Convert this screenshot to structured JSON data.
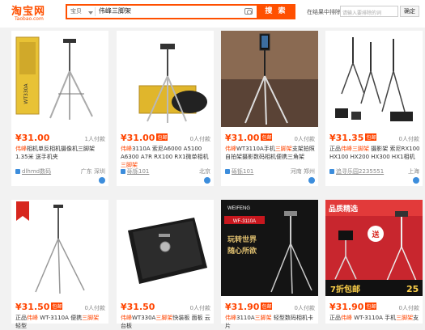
{
  "header": {
    "logo": "淘宝网",
    "logo_sub": "Taobao.com",
    "search_scope": "宝贝",
    "search_query": "伟峰三脚架",
    "search_button": "搜 索",
    "exclude_label": "在结果中排除",
    "exclude_placeholder": "请输入要排除的词",
    "exclude_button": "确定"
  },
  "products": [
    {
      "price": "¥31.00",
      "badge": "",
      "paid": "1人付款",
      "title_parts": [
        [
          "伟峰",
          true
        ],
        [
          "相机单反相机摄像机三脚架 1.35米 送手机夹",
          false
        ]
      ],
      "shop": "dlhmd数码",
      "location": "广东 深圳"
    },
    {
      "price": "¥31.00",
      "badge": "包邮",
      "paid": "0人付款",
      "title_parts": [
        [
          "伟峰",
          true
        ],
        [
          "3110A 索尼A6000 A5100 A6300 A7R RX100 RX1微单相机",
          false
        ],
        [
          "三脚架",
          true
        ]
      ],
      "shop": "砾铄101",
      "location": "北京"
    },
    {
      "price": "¥31.00",
      "badge": "包邮",
      "paid": "0人付款",
      "title_parts": [
        [
          "伟峰",
          true
        ],
        [
          "WT3110A手机",
          false
        ],
        [
          "三脚架",
          true
        ],
        [
          "支架拍照自拍架摄影数码相机便携三角架",
          false
        ]
      ],
      "shop": "砾铄101",
      "location": "河南 郑州"
    },
    {
      "price": "¥31.35",
      "badge": "包邮",
      "paid": "0人付款",
      "title_parts": [
        [
          "正品",
          false
        ],
        [
          "伟峰",
          true
        ],
        [
          "三脚架",
          true
        ],
        [
          " 摄影架 索尼RX100 HX100 HX200 HX300 HX1相机",
          false
        ]
      ],
      "shop": "追寻乐园2235551",
      "location": "上海"
    },
    {
      "price": "¥31.50",
      "badge": "包邮",
      "paid": "0人付款",
      "title_parts": [
        [
          "正品",
          false
        ],
        [
          "伟峰",
          true
        ],
        [
          " WT-3110A 便携",
          false
        ],
        [
          "三脚架",
          true
        ],
        [
          " 轻型",
          false
        ]
      ],
      "shop": "",
      "location": ""
    },
    {
      "price": "¥31.50",
      "badge": "",
      "paid": "0人付款",
      "title_parts": [
        [
          "伟峰",
          true
        ],
        [
          "WT330A",
          false
        ],
        [
          "三脚架",
          true
        ],
        [
          "快装板 面板 云台板",
          false
        ]
      ],
      "shop": "",
      "location": ""
    },
    {
      "price": "¥31.90",
      "badge": "包邮",
      "paid": "0人付款",
      "title_parts": [
        [
          "伟峰",
          true
        ],
        [
          "3110A",
          false
        ],
        [
          "三脚架",
          true
        ],
        [
          " 轻型数码相机卡片",
          false
        ]
      ],
      "shop": "",
      "location": ""
    },
    {
      "price": "¥31.90",
      "badge": "包邮",
      "paid": "0人付款",
      "title_parts": [
        [
          "正品",
          false
        ],
        [
          "伟峰",
          true
        ],
        [
          " WT-3110A 手机",
          false
        ],
        [
          "三脚架",
          true
        ],
        [
          "支",
          false
        ]
      ],
      "shop": "",
      "location": ""
    }
  ],
  "image_text": {
    "p1_box": "WT330A",
    "p7_brand": "WEIFENG",
    "p7_model": "WF-3110A",
    "p7_slogan1": "玩转世界",
    "p7_slogan2": "随心所欲",
    "p8_top": "品质精选",
    "p8_gift": "送",
    "p8_sale": "7折包邮",
    "p8_num": "25"
  }
}
